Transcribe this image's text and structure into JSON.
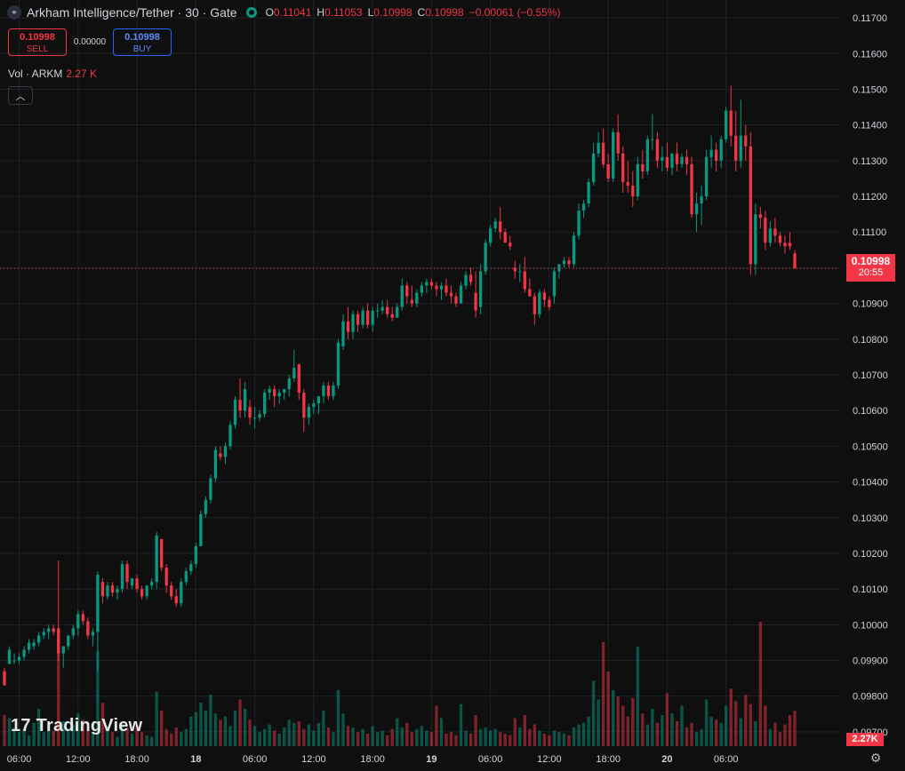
{
  "header": {
    "icon": "crosshair-icon",
    "title": "Arkham Intelligence/Tether · 30 · Gate",
    "o_key": "O",
    "o_val": "0.11041",
    "h_key": "H",
    "h_val": "0.11053",
    "l_key": "L",
    "l_val": "0.10998",
    "c_key": "C",
    "c_val": "0.10998",
    "change": "−0.00061 (−0.55%)"
  },
  "trade": {
    "sell_price": "0.10998",
    "sell_label": "SELL",
    "spread": "0.00000",
    "buy_price": "0.10998",
    "buy_label": "BUY"
  },
  "volume_legend": {
    "label": "Vol · ARKM",
    "value": "2.27 K"
  },
  "last_price": {
    "price": "0.10998",
    "countdown": "20:55"
  },
  "volume_badge": "2.27K",
  "logo": {
    "text": "TradingView",
    "icon": "tradingview-logo-icon"
  },
  "colors": {
    "up": "#089981",
    "down": "#f23645",
    "grid": "#1f2228",
    "text": "#d1d4dc",
    "background": "#0f0f0f"
  },
  "chart_data": {
    "type": "candlestick",
    "ylim": [
      0.0966,
      0.1175
    ],
    "y_ticks": [
      "0.11700",
      "0.11600",
      "0.11500",
      "0.11400",
      "0.11300",
      "0.11200",
      "0.11100",
      "0.11000",
      "0.10900",
      "0.10800",
      "0.10700",
      "0.10600",
      "0.10500",
      "0.10400",
      "0.10300",
      "0.10200",
      "0.10100",
      "0.10000",
      "0.09900",
      "0.09800",
      "0.09700"
    ],
    "x_ticks": [
      "06:00",
      "12:00",
      "18:00",
      "18",
      "06:00",
      "12:00",
      "18:00",
      "19",
      "06:00",
      "12:00",
      "18:00",
      "20",
      "06:00"
    ],
    "x_tick_candle_index": [
      3,
      15,
      27,
      39,
      51,
      63,
      75,
      87,
      99,
      111,
      123,
      135,
      147
    ],
    "last_price": 0.10998,
    "volume_scale_max": 8000,
    "candles": [
      [
        0.0987,
        0.0988,
        0.0983,
        0.0983,
        2000
      ],
      [
        0.0989,
        0.0994,
        0.0989,
        0.0993,
        1800
      ],
      [
        0.099,
        0.0992,
        0.0989,
        0.099,
        1200
      ],
      [
        0.099,
        0.0992,
        0.0989,
        0.0991,
        900
      ],
      [
        0.0991,
        0.0994,
        0.099,
        0.0993,
        1100
      ],
      [
        0.0993,
        0.0996,
        0.0992,
        0.0995,
        700
      ],
      [
        0.0994,
        0.0996,
        0.0993,
        0.0995,
        1500
      ],
      [
        0.0995,
        0.0998,
        0.0994,
        0.0997,
        2400
      ],
      [
        0.0997,
        0.0999,
        0.0996,
        0.0998,
        900
      ],
      [
        0.0998,
        0.1,
        0.0996,
        0.0999,
        1300
      ],
      [
        0.0999,
        0.1,
        0.0997,
        0.0998,
        1000
      ],
      [
        0.0999,
        0.1018,
        0.099,
        0.0992,
        7200
      ],
      [
        0.0992,
        0.0994,
        0.0988,
        0.0994,
        1600
      ],
      [
        0.0994,
        0.0997,
        0.0993,
        0.0997,
        1100
      ],
      [
        0.0997,
        0.1,
        0.0996,
        0.0999,
        1400
      ],
      [
        0.0999,
        0.1004,
        0.0997,
        0.1003,
        2100
      ],
      [
        0.1003,
        0.1004,
        0.1,
        0.1001,
        1700
      ],
      [
        0.1001,
        0.1002,
        0.0996,
        0.0997,
        1000
      ],
      [
        0.0997,
        0.0999,
        0.0994,
        0.0998,
        900
      ],
      [
        0.0998,
        0.1015,
        0.0987,
        0.1014,
        6100
      ],
      [
        0.1012,
        0.1013,
        0.1006,
        0.1008,
        2800
      ],
      [
        0.1008,
        0.1012,
        0.1007,
        0.1011,
        1300
      ],
      [
        0.1011,
        0.1012,
        0.1008,
        0.1009,
        900
      ],
      [
        0.1009,
        0.1011,
        0.1007,
        0.101,
        600
      ],
      [
        0.101,
        0.1018,
        0.1009,
        0.1017,
        1500
      ],
      [
        0.1017,
        0.1018,
        0.101,
        0.1012,
        1200
      ],
      [
        0.1011,
        0.1013,
        0.101,
        0.1013,
        800
      ],
      [
        0.1013,
        0.1014,
        0.1009,
        0.101,
        1300
      ],
      [
        0.101,
        0.1011,
        0.1007,
        0.1008,
        900
      ],
      [
        0.1008,
        0.1011,
        0.1007,
        0.1011,
        700
      ],
      [
        0.1011,
        0.1013,
        0.101,
        0.1012,
        600
      ],
      [
        0.1012,
        0.1026,
        0.101,
        0.1025,
        3500
      ],
      [
        0.1024,
        0.1024,
        0.1015,
        0.1016,
        2300
      ],
      [
        0.1016,
        0.1017,
        0.1009,
        0.1011,
        1100
      ],
      [
        0.1011,
        0.1012,
        0.1007,
        0.1008,
        800
      ],
      [
        0.1008,
        0.101,
        0.1005,
        0.1006,
        1200
      ],
      [
        0.1006,
        0.1013,
        0.1005,
        0.1012,
        900
      ],
      [
        0.1012,
        0.1016,
        0.1011,
        0.1015,
        1100
      ],
      [
        0.1015,
        0.1018,
        0.1014,
        0.1017,
        1900
      ],
      [
        0.1017,
        0.1023,
        0.1016,
        0.1022,
        2200
      ],
      [
        0.1022,
        0.1032,
        0.1022,
        0.1031,
        2800
      ],
      [
        0.1031,
        0.1036,
        0.103,
        0.1035,
        2300
      ],
      [
        0.1035,
        0.1042,
        0.1034,
        0.1041,
        3300
      ],
      [
        0.1041,
        0.105,
        0.104,
        0.1049,
        2100
      ],
      [
        0.1048,
        0.105,
        0.1046,
        0.1047,
        1700
      ],
      [
        0.1047,
        0.1051,
        0.1045,
        0.105,
        1900
      ],
      [
        0.105,
        0.1057,
        0.1049,
        0.1056,
        1300
      ],
      [
        0.1056,
        0.1064,
        0.1055,
        0.1063,
        2300
      ],
      [
        0.1063,
        0.1069,
        0.1058,
        0.106,
        3000
      ],
      [
        0.106,
        0.1068,
        0.1058,
        0.1066,
        2400
      ],
      [
        0.1061,
        0.1063,
        0.1056,
        0.1058,
        1700
      ],
      [
        0.1058,
        0.1061,
        0.1055,
        0.1058,
        1300
      ],
      [
        0.1058,
        0.106,
        0.1057,
        0.1059,
        900
      ],
      [
        0.1059,
        0.1066,
        0.1058,
        0.1065,
        1100
      ],
      [
        0.1065,
        0.1067,
        0.1063,
        0.1066,
        1400
      ],
      [
        0.1066,
        0.1067,
        0.1061,
        0.1064,
        1000
      ],
      [
        0.1064,
        0.1066,
        0.1062,
        0.1065,
        800
      ],
      [
        0.1065,
        0.1066,
        0.1063,
        0.1066,
        1200
      ],
      [
        0.1066,
        0.107,
        0.1064,
        0.1069,
        1700
      ],
      [
        0.1069,
        0.1077,
        0.1068,
        0.1072,
        1500
      ],
      [
        0.1073,
        0.1073,
        0.1063,
        0.1065,
        1600
      ],
      [
        0.1065,
        0.1066,
        0.1054,
        0.1058,
        1100
      ],
      [
        0.1058,
        0.1062,
        0.1056,
        0.1061,
        1400
      ],
      [
        0.1061,
        0.1063,
        0.1059,
        0.1062,
        1000
      ],
      [
        0.1062,
        0.1064,
        0.1059,
        0.1064,
        1500
      ],
      [
        0.1064,
        0.1068,
        0.1062,
        0.1067,
        2300
      ],
      [
        0.1067,
        0.1068,
        0.1063,
        0.1064,
        1200
      ],
      [
        0.1064,
        0.1068,
        0.1063,
        0.1067,
        900
      ],
      [
        0.1067,
        0.108,
        0.1066,
        0.1079,
        3600
      ],
      [
        0.1078,
        0.1087,
        0.1077,
        0.1085,
        2100
      ],
      [
        0.1085,
        0.1089,
        0.108,
        0.1082,
        1300
      ],
      [
        0.1082,
        0.1088,
        0.108,
        0.1087,
        1200
      ],
      [
        0.1087,
        0.1088,
        0.1082,
        0.1084,
        900
      ],
      [
        0.1084,
        0.1089,
        0.1083,
        0.1088,
        1100
      ],
      [
        0.1088,
        0.109,
        0.1083,
        0.1084,
        800
      ],
      [
        0.1084,
        0.1089,
        0.1082,
        0.1088,
        1300
      ],
      [
        0.1088,
        0.109,
        0.1086,
        0.1088,
        900
      ],
      [
        0.1088,
        0.1091,
        0.1087,
        0.1089,
        1000
      ],
      [
        0.1089,
        0.1091,
        0.1086,
        0.1087,
        700
      ],
      [
        0.1087,
        0.1089,
        0.1085,
        0.1086,
        1100
      ],
      [
        0.1086,
        0.109,
        0.1086,
        0.1089,
        1800
      ],
      [
        0.1089,
        0.1097,
        0.1088,
        0.1095,
        1200
      ],
      [
        0.1095,
        0.1096,
        0.109,
        0.1092,
        1500
      ],
      [
        0.1091,
        0.1095,
        0.1089,
        0.109,
        900
      ],
      [
        0.109,
        0.1094,
        0.1089,
        0.1093,
        1100
      ],
      [
        0.1093,
        0.1096,
        0.1092,
        0.1095,
        1300
      ],
      [
        0.1095,
        0.1097,
        0.1093,
        0.1096,
        1000
      ],
      [
        0.1096,
        0.1097,
        0.1094,
        0.1095,
        900
      ],
      [
        0.1095,
        0.1096,
        0.1092,
        0.1094,
        2600
      ],
      [
        0.1094,
        0.1096,
        0.1091,
        0.1095,
        1800
      ],
      [
        0.1095,
        0.1097,
        0.1092,
        0.1093,
        800
      ],
      [
        0.1093,
        0.1095,
        0.109,
        0.1092,
        900
      ],
      [
        0.1092,
        0.1093,
        0.1089,
        0.109,
        700
      ],
      [
        0.109,
        0.1096,
        0.109,
        0.1095,
        2700
      ],
      [
        0.1095,
        0.1099,
        0.1094,
        0.1098,
        1000
      ],
      [
        0.1098,
        0.11,
        0.1095,
        0.1096,
        800
      ],
      [
        0.1093,
        0.1099,
        0.1086,
        0.1088,
        2000
      ],
      [
        0.1089,
        0.1101,
        0.1087,
        0.1099,
        1100
      ],
      [
        0.1099,
        0.1108,
        0.1098,
        0.1107,
        1200
      ],
      [
        0.1107,
        0.1112,
        0.1106,
        0.1111,
        1000
      ],
      [
        0.1111,
        0.1114,
        0.111,
        0.1113,
        1100
      ],
      [
        0.1113,
        0.1117,
        0.1108,
        0.111,
        900
      ],
      [
        0.111,
        0.1111,
        0.1107,
        0.1107,
        800
      ],
      [
        0.1107,
        0.1109,
        0.1105,
        0.1106,
        700
      ],
      [
        0.11,
        0.1102,
        0.1097,
        0.1099,
        1800
      ],
      [
        0.1099,
        0.1101,
        0.1096,
        0.1099,
        1200
      ],
      [
        0.1099,
        0.1103,
        0.1093,
        0.1094,
        2000
      ],
      [
        0.1094,
        0.1097,
        0.1092,
        0.1092,
        1100
      ],
      [
        0.1092,
        0.1093,
        0.1084,
        0.1087,
        1400
      ],
      [
        0.1087,
        0.1094,
        0.1086,
        0.1093,
        1000
      ],
      [
        0.1093,
        0.1094,
        0.1089,
        0.1091,
        800
      ],
      [
        0.1091,
        0.1092,
        0.1088,
        0.1089,
        700
      ],
      [
        0.1092,
        0.11,
        0.109,
        0.1099,
        1000
      ],
      [
        0.1099,
        0.1101,
        0.1097,
        0.1101,
        900
      ],
      [
        0.1101,
        0.1103,
        0.11,
        0.1102,
        800
      ],
      [
        0.1102,
        0.1103,
        0.11,
        0.1101,
        700
      ],
      [
        0.1101,
        0.111,
        0.11,
        0.1109,
        1200
      ],
      [
        0.1109,
        0.1118,
        0.1108,
        0.1116,
        1400
      ],
      [
        0.1116,
        0.1119,
        0.1114,
        0.1118,
        1500
      ],
      [
        0.1118,
        0.1125,
        0.1117,
        0.1124,
        1900
      ],
      [
        0.1124,
        0.1135,
        0.1123,
        0.1132,
        4200
      ],
      [
        0.1132,
        0.1138,
        0.1131,
        0.1135,
        3000
      ],
      [
        0.1135,
        0.1139,
        0.1128,
        0.1129,
        6700
      ],
      [
        0.1129,
        0.1132,
        0.1124,
        0.1125,
        4800
      ],
      [
        0.1125,
        0.1139,
        0.1124,
        0.1138,
        3600
      ],
      [
        0.1138,
        0.1143,
        0.113,
        0.1132,
        3200
      ],
      [
        0.1132,
        0.1134,
        0.1121,
        0.1124,
        2600
      ],
      [
        0.1124,
        0.113,
        0.1121,
        0.1123,
        1900
      ],
      [
        0.1123,
        0.1127,
        0.1117,
        0.112,
        3100
      ],
      [
        0.112,
        0.1131,
        0.1119,
        0.1129,
        6400
      ],
      [
        0.1129,
        0.1133,
        0.1125,
        0.1127,
        2100
      ],
      [
        0.1127,
        0.1137,
        0.1126,
        0.1136,
        1400
      ],
      [
        0.1136,
        0.1143,
        0.1133,
        0.1136,
        2400
      ],
      [
        0.1136,
        0.1138,
        0.1128,
        0.113,
        1500
      ],
      [
        0.113,
        0.1134,
        0.1127,
        0.1131,
        2000
      ],
      [
        0.1131,
        0.1135,
        0.1127,
        0.1128,
        3400
      ],
      [
        0.1128,
        0.1132,
        0.1126,
        0.1132,
        2100
      ],
      [
        0.1132,
        0.1135,
        0.1127,
        0.1129,
        1600
      ],
      [
        0.1129,
        0.1132,
        0.1128,
        0.1131,
        2600
      ],
      [
        0.1131,
        0.1133,
        0.1126,
        0.1129,
        1200
      ],
      [
        0.1129,
        0.1131,
        0.1114,
        0.1115,
        1500
      ],
      [
        0.1115,
        0.1121,
        0.111,
        0.1118,
        900
      ],
      [
        0.1118,
        0.1123,
        0.1112,
        0.112,
        1100
      ],
      [
        0.112,
        0.1133,
        0.1119,
        0.1131,
        3000
      ],
      [
        0.1131,
        0.1137,
        0.1128,
        0.1133,
        1900
      ],
      [
        0.1133,
        0.1135,
        0.1127,
        0.113,
        1700
      ],
      [
        0.113,
        0.1137,
        0.1128,
        0.1136,
        1500
      ],
      [
        0.1136,
        0.1145,
        0.1135,
        0.1144,
        2600
      ],
      [
        0.1144,
        0.1151,
        0.1134,
        0.1137,
        3700
      ],
      [
        0.1137,
        0.1144,
        0.1127,
        0.113,
        2900
      ],
      [
        0.113,
        0.1147,
        0.1128,
        0.1137,
        1800
      ],
      [
        0.1137,
        0.114,
        0.113,
        0.1134,
        3300
      ],
      [
        0.1134,
        0.1138,
        0.1098,
        0.1101,
        2700
      ],
      [
        0.1101,
        0.1118,
        0.1098,
        0.1115,
        1600
      ],
      [
        0.1115,
        0.1117,
        0.1111,
        0.1114,
        8000
      ],
      [
        0.1114,
        0.1116,
        0.1105,
        0.1107,
        2600
      ],
      [
        0.1107,
        0.1113,
        0.1106,
        0.1111,
        1100
      ],
      [
        0.1111,
        0.1114,
        0.1107,
        0.1109,
        1500
      ],
      [
        0.1109,
        0.111,
        0.1106,
        0.1107,
        900
      ],
      [
        0.1107,
        0.1109,
        0.1104,
        0.1106,
        1400
      ],
      [
        0.1107,
        0.111,
        0.1105,
        0.1106,
        2000
      ],
      [
        0.1104,
        0.1105,
        0.10998,
        0.10998,
        2270
      ]
    ]
  }
}
